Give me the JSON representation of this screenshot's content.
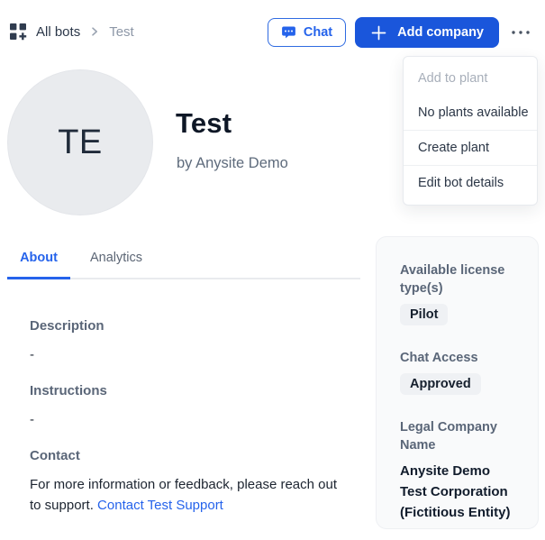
{
  "colors": {
    "primary_blue": "#1a56db",
    "link_blue": "#2563eb",
    "dark_text": "#2b3749",
    "muted_text": "#8d97a7",
    "card_bg": "#f9fafb",
    "badge_bg": "#eff1f4"
  },
  "breadcrumb": {
    "root": "All bots",
    "current": "Test"
  },
  "header_actions": {
    "chat_label": "Chat",
    "add_company_label": "Add company"
  },
  "dropdown_menu": {
    "items": [
      {
        "label": "Add to plant",
        "disabled": true
      },
      {
        "label": "No plants available",
        "disabled": false
      },
      {
        "label": "Create plant",
        "disabled": false
      },
      {
        "label": "Edit bot details",
        "disabled": false
      }
    ]
  },
  "profile": {
    "initials": "TE",
    "title": "Test",
    "byline": "by Anysite Demo"
  },
  "tabs": [
    {
      "label": "About",
      "active": true
    },
    {
      "label": "Analytics",
      "active": false
    }
  ],
  "about": {
    "sections": [
      {
        "heading": "Description",
        "value": "-"
      },
      {
        "heading": "Instructions",
        "value": "-"
      },
      {
        "heading": "Contact"
      }
    ],
    "contact_text": "For more information or feedback, please reach out to support. ",
    "contact_link_label": "Contact Test Support"
  },
  "info_card": {
    "license_heading": "Available license type(s)",
    "license_badge": "Pilot",
    "chat_access_heading": "Chat Access",
    "chat_access_badge": "Approved",
    "legal_heading": "Legal Company Name",
    "legal_value": "Anysite Demo Test Corporation (Fictitious Entity)"
  }
}
